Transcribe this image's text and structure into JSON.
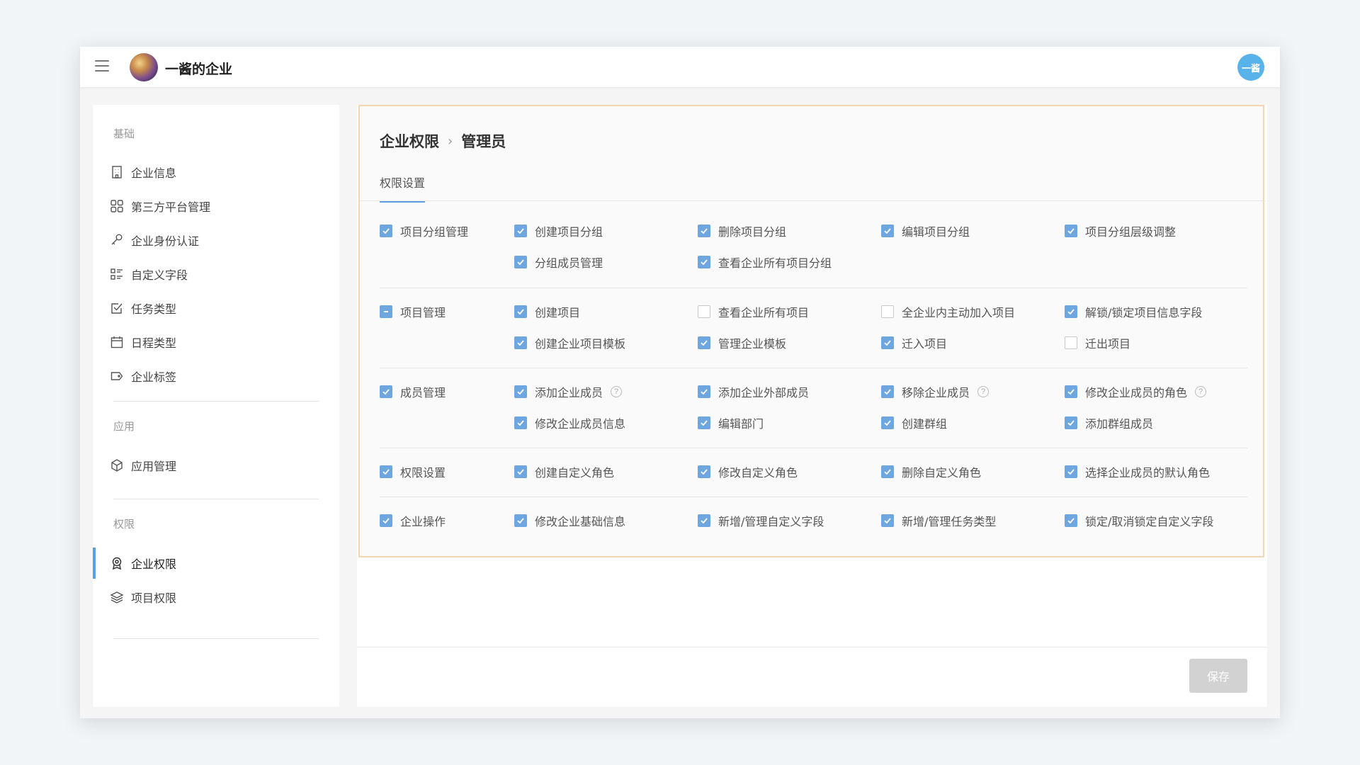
{
  "header": {
    "org_name": "一酱的企业",
    "user_initials": "一酱"
  },
  "sidebar": {
    "sections": [
      {
        "title": "基础"
      },
      {
        "title": "应用"
      },
      {
        "title": "权限"
      }
    ],
    "items": [
      {
        "label": "企业信息",
        "icon": "building-icon"
      },
      {
        "label": "第三方平台管理",
        "icon": "grid-apps-icon"
      },
      {
        "label": "企业身份认证",
        "icon": "key-icon"
      },
      {
        "label": "自定义字段",
        "icon": "list-fields-icon"
      },
      {
        "label": "任务类型",
        "icon": "checkbox-task-icon"
      },
      {
        "label": "日程类型",
        "icon": "calendar-icon"
      },
      {
        "label": "企业标签",
        "icon": "tag-icon"
      },
      {
        "label": "应用管理",
        "icon": "cube-icon"
      },
      {
        "label": "企业权限",
        "icon": "badge-icon",
        "active": true
      },
      {
        "label": "项目权限",
        "icon": "layers-icon"
      }
    ]
  },
  "main": {
    "breadcrumb": [
      "企业权限",
      "管理员"
    ],
    "tab": "权限设置",
    "save_label": "保存",
    "groups": [
      {
        "label": "项目分组管理",
        "state": "checked",
        "items": [
          {
            "label": "创建项目分组",
            "state": "checked"
          },
          {
            "label": "删除项目分组",
            "state": "checked"
          },
          {
            "label": "编辑项目分组",
            "state": "checked"
          },
          {
            "label": "项目分组层级调整",
            "state": "checked"
          },
          {
            "label": "分组成员管理",
            "state": "checked"
          },
          {
            "label": "查看企业所有项目分组",
            "state": "checked"
          }
        ]
      },
      {
        "label": "项目管理",
        "state": "partial",
        "items": [
          {
            "label": "创建项目",
            "state": "checked"
          },
          {
            "label": "查看企业所有项目",
            "state": "unchecked"
          },
          {
            "label": "全企业内主动加入项目",
            "state": "unchecked"
          },
          {
            "label": "解锁/锁定项目信息字段",
            "state": "checked"
          },
          {
            "label": "创建企业项目模板",
            "state": "checked"
          },
          {
            "label": "管理企业模板",
            "state": "checked"
          },
          {
            "label": "迁入项目",
            "state": "checked"
          },
          {
            "label": "迁出项目",
            "state": "unchecked"
          }
        ]
      },
      {
        "label": "成员管理",
        "state": "checked",
        "items": [
          {
            "label": "添加企业成员",
            "state": "checked",
            "help": true
          },
          {
            "label": "添加企业外部成员",
            "state": "checked"
          },
          {
            "label": "移除企业成员",
            "state": "checked",
            "help": true
          },
          {
            "label": "修改企业成员的角色",
            "state": "checked",
            "help": true
          },
          {
            "label": "修改企业成员信息",
            "state": "checked"
          },
          {
            "label": "编辑部门",
            "state": "checked"
          },
          {
            "label": "创建群组",
            "state": "checked"
          },
          {
            "label": "添加群组成员",
            "state": "checked"
          }
        ]
      },
      {
        "label": "权限设置",
        "state": "checked",
        "items": [
          {
            "label": "创建自定义角色",
            "state": "checked"
          },
          {
            "label": "修改自定义角色",
            "state": "checked"
          },
          {
            "label": "删除自定义角色",
            "state": "checked"
          },
          {
            "label": "选择企业成员的默认角色",
            "state": "checked"
          }
        ]
      },
      {
        "label": "企业操作",
        "state": "checked",
        "items": [
          {
            "label": "修改企业基础信息",
            "state": "checked"
          },
          {
            "label": "新增/管理自定义字段",
            "state": "checked"
          },
          {
            "label": "新增/管理任务类型",
            "state": "checked"
          },
          {
            "label": "锁定/取消锁定自定义字段",
            "state": "checked"
          }
        ]
      }
    ]
  }
}
